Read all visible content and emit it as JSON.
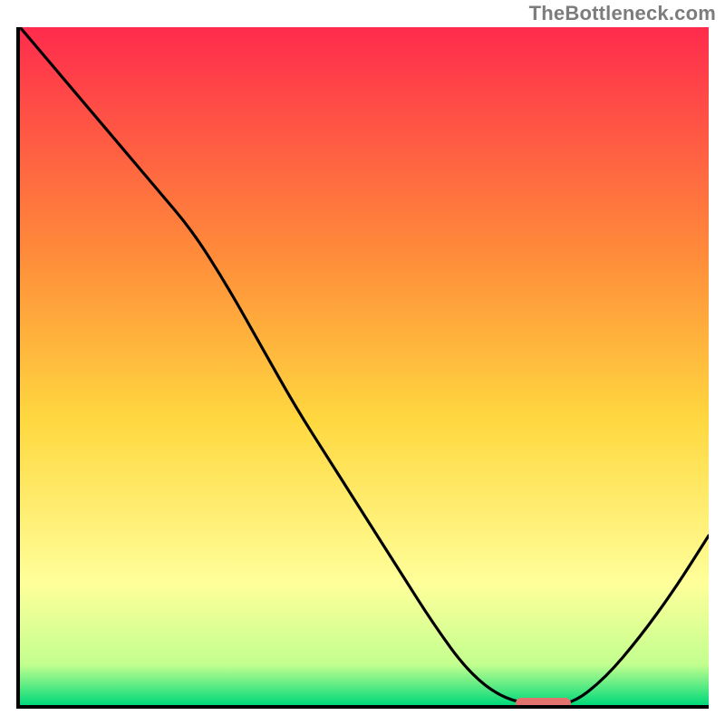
{
  "attribution": "TheBottleneck.com",
  "colors": {
    "gradient_top": "#ff2b4d",
    "gradient_mid_upper": "#ff8a3a",
    "gradient_mid": "#ffd83f",
    "gradient_lower": "#ffff9a",
    "gradient_near_bottom": "#c3ff8f",
    "gradient_bottom": "#00d97a",
    "curve": "#000000",
    "axis": "#000000",
    "marker": "#e2726d"
  },
  "chart_data": {
    "type": "line",
    "title": "",
    "xlabel": "",
    "ylabel": "",
    "xlim": [
      0,
      100
    ],
    "ylim": [
      0,
      100
    ],
    "x": [
      0,
      5,
      10,
      15,
      20,
      25,
      30,
      35,
      40,
      45,
      50,
      55,
      60,
      65,
      70,
      75,
      80,
      85,
      90,
      95,
      100
    ],
    "values": [
      100,
      94,
      88,
      82,
      76,
      70,
      62,
      53,
      44,
      36,
      28,
      20,
      12,
      5,
      1,
      0,
      0,
      4,
      10,
      17,
      25
    ],
    "optimum_x": 76,
    "marker": {
      "x_start": 72,
      "x_end": 80,
      "y": 0
    }
  }
}
